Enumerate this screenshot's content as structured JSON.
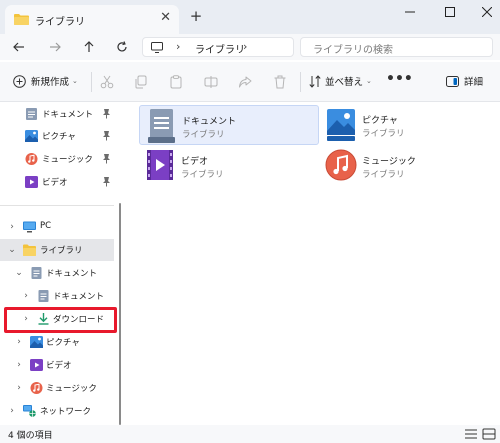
{
  "window": {
    "tab_title": "ライブラリ",
    "tab_close": "✕",
    "new_tab": "+"
  },
  "address": {
    "path_chevron": "›",
    "current": "ライブラリ",
    "trailing_chevron": "›",
    "search_placeholder": "ライブラリの検索"
  },
  "commands": {
    "new_label": "新規作成",
    "new_caret": "⌄",
    "sort_label": "並べ替え",
    "sort_caret": "⌄",
    "more": "•••",
    "details_label": "詳細"
  },
  "sidebar": {
    "quick_access": [
      {
        "label": "ドキュメント",
        "icon": "document-folder-icon"
      },
      {
        "label": "ピクチャ",
        "icon": "pictures-folder-icon"
      },
      {
        "label": "ミュージック",
        "icon": "music-folder-icon"
      },
      {
        "label": "ビデオ",
        "icon": "videos-folder-icon"
      }
    ],
    "tree": [
      {
        "label": "PC",
        "icon": "pc-icon",
        "chevron": "›"
      },
      {
        "label": "ライブラリ",
        "icon": "library-folder-icon",
        "chevron": "⌄",
        "selected": true
      },
      {
        "label": "ドキュメント",
        "icon": "document-library-icon",
        "chevron": "⌄"
      },
      {
        "label": "ドキュメント",
        "icon": "document-library-icon",
        "chevron": "›"
      },
      {
        "label": "ダウンロード",
        "icon": "download-icon",
        "chevron": "›"
      },
      {
        "label": "ピクチャ",
        "icon": "pictures-folder-icon",
        "chevron": "›"
      },
      {
        "label": "ビデオ",
        "icon": "videos-folder-icon",
        "chevron": "›"
      },
      {
        "label": "ミュージック",
        "icon": "music-folder-icon",
        "chevron": "›"
      },
      {
        "label": "ネットワーク",
        "icon": "network-icon",
        "chevron": "›"
      }
    ]
  },
  "libraries": [
    {
      "name": "ドキュメント",
      "type": "ライブラリ",
      "icon": "documents-library-icon",
      "selected": true
    },
    {
      "name": "ピクチャ",
      "type": "ライブラリ",
      "icon": "pictures-library-icon"
    },
    {
      "name": "ビデオ",
      "type": "ライブラリ",
      "icon": "videos-library-icon"
    },
    {
      "name": "ミュージック",
      "type": "ライブラリ",
      "icon": "music-library-icon"
    }
  ],
  "status": {
    "item_count": "4 個の項目"
  },
  "colors": {
    "accent": "#0067c0",
    "highlight": "#e8192c",
    "folder": "#f3c33c"
  }
}
